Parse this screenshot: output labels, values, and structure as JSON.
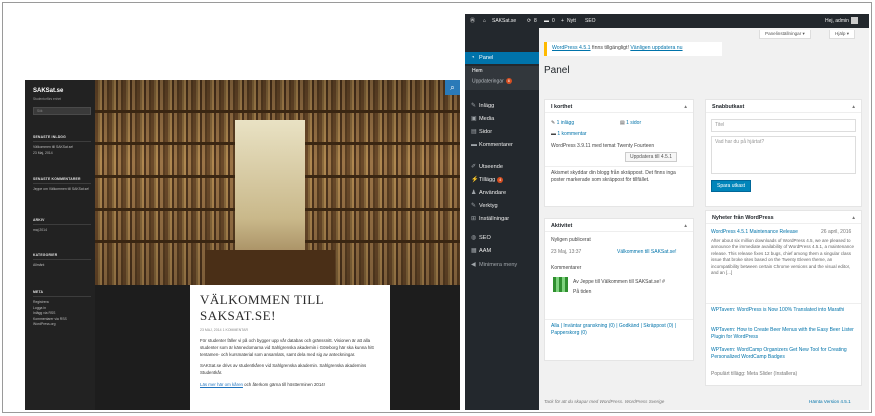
{
  "site": {
    "title": "SAKSat.se",
    "description": "Studentorförs enhet",
    "search_placeholder": "Sök",
    "widgets": [
      {
        "heading": "SENASTE INLÄGG",
        "lines": [
          "Välkommen till SAKSat.se!",
          "23 Maj, 2014"
        ]
      },
      {
        "heading": "SENASTE KOMMENTARER",
        "lines": [
          "Jeppe om Välkommen till SAKSat.se!"
        ]
      },
      {
        "heading": "ARKIV",
        "lines": [
          "maj 2014"
        ]
      },
      {
        "heading": "KATEGORIER",
        "lines": [
          "Allmänt"
        ]
      },
      {
        "heading": "META",
        "lines": [
          "Registrera",
          "Logga in",
          "Inlägg via RSS",
          "Kommentarer via RSS",
          "WordPress.org"
        ]
      }
    ],
    "search_icon": "search-icon",
    "post": {
      "title": "VÄLKOMMEN TILL SAKSAT.SE!",
      "meta": "23 MAJ, 2014   1 KOMMENTAR",
      "p1": "För studenter fäller vi på och bygger upp vår databas och gränssnitt. Visionen är att alla studenter som är kännedomarna vid Sahlgrenska akademin i Göteborg här ska kunna hitt tentamen- och kursmaterial som ansamlats, samt dela med sig av anteckningar.",
      "p2": "SAKSat.se drivs av studentkåren vid Sahlgrenska akademin. Sahlgrenska akademins Studentkår.",
      "link": "Läs mer här om kåren",
      "p3_tail": " och återkom gärna till höstterminen 2014!"
    }
  },
  "admin": {
    "bar": {
      "wp_icon": "wordpress-icon",
      "site": "SAKSat.se",
      "updates_count": "8",
      "comments_count": "0",
      "new": "Nytt",
      "seo": "SEO",
      "greeting": "Hej, admin"
    },
    "menu": [
      {
        "icon": "dashboard-icon",
        "glyph": "◔",
        "label": "Panel"
      },
      {
        "icon": "pin-icon",
        "glyph": "✎",
        "label": "Inlägg"
      },
      {
        "icon": "media-icon",
        "glyph": "▣",
        "label": "Media"
      },
      {
        "icon": "pages-icon",
        "glyph": "▤",
        "label": "Sidor"
      },
      {
        "icon": "comments-icon",
        "glyph": "▬",
        "label": "Kommentarer"
      },
      {
        "icon": "appearance-icon",
        "glyph": "✐",
        "label": "Utseende"
      },
      {
        "icon": "plugins-icon",
        "glyph": "⚡",
        "label": "Tillägg",
        "badge": "4"
      },
      {
        "icon": "users-icon",
        "glyph": "♟",
        "label": "Användare"
      },
      {
        "icon": "tools-icon",
        "glyph": "✎",
        "label": "Verktyg"
      },
      {
        "icon": "settings-icon",
        "glyph": "⊞",
        "label": "Inställningar"
      },
      {
        "icon": "seo-icon",
        "glyph": "◍",
        "label": "SEO"
      },
      {
        "icon": "aam-icon",
        "glyph": "▦",
        "label": "AAM"
      },
      {
        "icon": "collapse-icon",
        "glyph": "◀",
        "label": "Minimera meny"
      }
    ],
    "submenu": {
      "home": "Hem",
      "updates": "Uppdateringar",
      "updates_badge": "8"
    },
    "screen_options": "Panelinställningar ▾",
    "help": "Hjälp ▾",
    "notice": {
      "version_text": "WordPress 4.5.1",
      "mid": " finns tillgängligt! ",
      "update_link": "Vänligen uppdatera nu"
    },
    "page_title": "Panel",
    "at_a_glance": {
      "title": "I korthet",
      "posts": "1 inlägg",
      "pages": "1 sidor",
      "comments": "1 kommentar",
      "theme_text": "WordPress 3.9.11 med temat Twenty Fourteen",
      "update_button": "Uppdatera till 4.5.1",
      "akismet": "Akismet skyddar din blogg från skräppost. Det finns inga poster markerade som skräppost för tillfället."
    },
    "activity": {
      "title": "Aktivitet",
      "recent_heading": "Nyligen publicerat",
      "recent_date": "23 Maj, 13:37",
      "recent_post": "Välkommen till SAKSat.se!",
      "comments_heading": "Kommentarer",
      "comment_text": "Av Jeppe till Välkommen till SAKSat.se! #",
      "comment_body": "På tiden",
      "filters": "Alla | Inväntar granskning (0) | Godkänd | Skräppost (0) | Papperskorg (0)"
    },
    "quick_draft": {
      "title": "Snabbutkast",
      "title_placeholder": "Titel",
      "body_placeholder": "Vad har du på hjärtat?",
      "save_button": "Spara utkast"
    },
    "news": {
      "title": "Nyheter från WordPress",
      "headline": "WordPress 4.5.1 Maintenance Release",
      "date": "26 april, 2016",
      "excerpt": "After about six million downloads of WordPress 4.5, we are pleased to announce the immediate availability of WordPress 4.5.1, a maintenance release. This release fixes 12 bugs, chief among them a singular class issue that broke sites based on the Twenty Eleven theme, an incompatibility between certain Chrome versions and the visual editor, and an [...]",
      "items": [
        "WPTavern: WordPress is Now 100% Translated into Marathi",
        "WPTavern: How to Create Beer Menus with the Easy Beer Lister Plugin for WordPress",
        "WPTavern: WordCamp Organizers Get New Tool for Creating Personalized WordCamp Badges"
      ],
      "popular": "Populärt tillägg: Meta Slider (Installera)"
    },
    "footer_left": "Tack för att du skapar med WordPress. WordPress Sverige",
    "footer_right": "Hämta Version 4.5.1"
  }
}
